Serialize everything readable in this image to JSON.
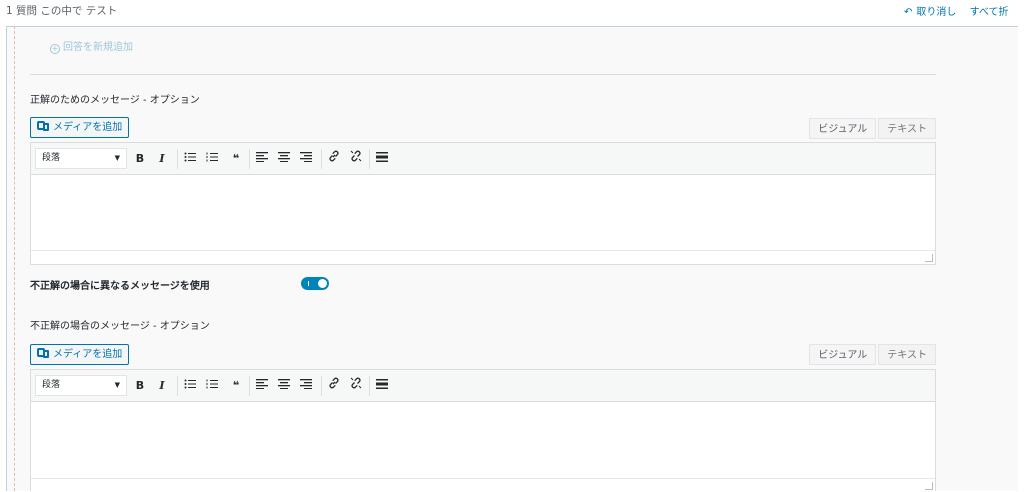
{
  "header": {
    "title": "1 質問 この中で テスト",
    "undo_label": "取り消し",
    "expand_label": "すべて折"
  },
  "answers": {
    "add_label": "回答を新規追加"
  },
  "correct_message": {
    "label": "正解のためのメッセージ - オプション",
    "media_button": "メディアを追加",
    "tab_visual": "ビジュアル",
    "tab_text": "テキスト",
    "format_select": "段落"
  },
  "incorrect_toggle": {
    "label": "不正解の場合に異なるメッセージを使用",
    "enabled": true
  },
  "incorrect_message": {
    "label": "不正解の場合のメッセージ - オプション",
    "media_button": "メディアを追加",
    "tab_visual": "ビジュアル",
    "tab_text": "テキスト",
    "format_select": "段落"
  },
  "toolbar": {
    "bold": "B",
    "italic": "I",
    "quote": "❝"
  },
  "colors": {
    "accent": "#0073aa",
    "toggle_on": "#0085ba"
  }
}
